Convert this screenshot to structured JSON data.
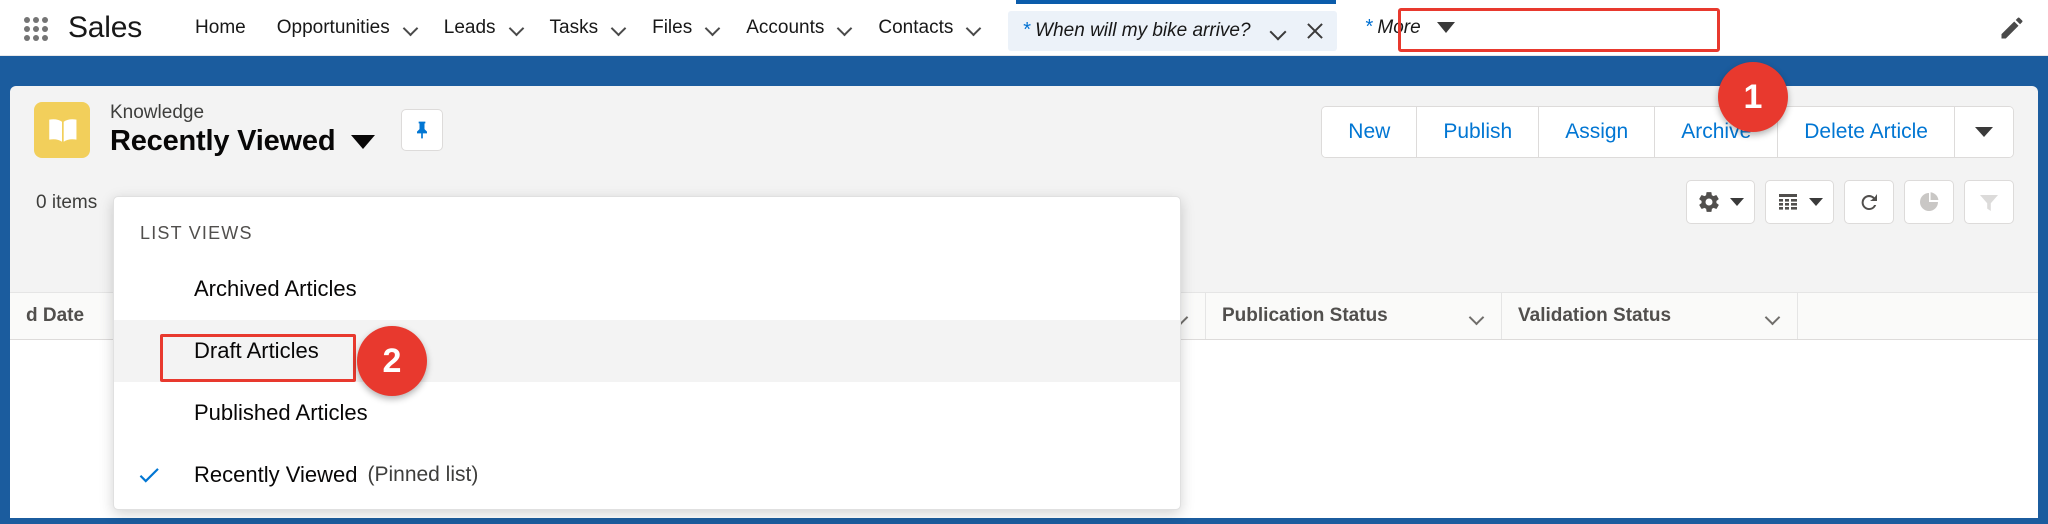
{
  "topnav": {
    "app_launcher": "app-launcher-grid-icon",
    "app_name": "Sales",
    "items": [
      {
        "label": "Home",
        "has_caret": false
      },
      {
        "label": "Opportunities",
        "has_caret": true
      },
      {
        "label": "Leads",
        "has_caret": true
      },
      {
        "label": "Tasks",
        "has_caret": true
      },
      {
        "label": "Files",
        "has_caret": true
      },
      {
        "label": "Accounts",
        "has_caret": true
      },
      {
        "label": "Contacts",
        "has_caret": true
      }
    ],
    "active_tab": {
      "star": "*",
      "title": "When will my bike arrive?",
      "caret_icon": "chevron-down-icon",
      "close_icon": "close-icon"
    },
    "more": {
      "star": "*",
      "label": "More",
      "caret_icon": "caret-down-icon"
    },
    "edit_icon": "pencil-icon"
  },
  "header": {
    "object_icon": "knowledge-book-icon",
    "object_name": "Knowledge",
    "list_view_name": "Recently Viewed",
    "list_view_caret_icon": "caret-down-icon",
    "pin_icon": "pin-icon",
    "actions": [
      {
        "label": "New"
      },
      {
        "label": "Publish"
      },
      {
        "label": "Assign"
      },
      {
        "label": "Archive"
      },
      {
        "label": "Delete Article"
      }
    ],
    "actions_more_icon": "caret-down-icon"
  },
  "subtoolbar": {
    "items_count": "0 items",
    "tools": [
      {
        "icon": "gear-icon",
        "has_caret": true
      },
      {
        "icon": "table-view-icon",
        "has_caret": true
      },
      {
        "icon": "refresh-icon",
        "has_caret": false
      },
      {
        "icon": "chart-icon",
        "has_caret": false
      },
      {
        "icon": "filter-funnel-icon",
        "has_caret": false
      }
    ]
  },
  "table": {
    "columns": [
      {
        "label": "d Date",
        "caret_icon": "chevron-down-icon"
      },
      {
        "label": "Publication Status",
        "caret_icon": "chevron-down-icon"
      },
      {
        "label": "Validation Status",
        "caret_icon": "chevron-down-icon"
      }
    ],
    "rows": []
  },
  "dropdown": {
    "title": "LIST VIEWS",
    "items": [
      {
        "label": "Archived Articles",
        "selected": false,
        "hover": false,
        "sub": ""
      },
      {
        "label": "Draft Articles",
        "selected": false,
        "hover": true,
        "sub": ""
      },
      {
        "label": "Published Articles",
        "selected": false,
        "hover": false,
        "sub": ""
      },
      {
        "label": "Recently Viewed",
        "selected": true,
        "hover": false,
        "sub": "(Pinned list)"
      }
    ]
  },
  "annotations": [
    {
      "number": "1",
      "target": "active-tab"
    },
    {
      "number": "2",
      "target": "draft-articles-menu-item"
    }
  ],
  "colors": {
    "accent_blue": "#0176d3",
    "link_blue": "#0070d2",
    "annotation_red": "#e8392e",
    "knowledge_yellow": "#f2cf5b",
    "backdrop_blue": "#1b5c9e"
  }
}
